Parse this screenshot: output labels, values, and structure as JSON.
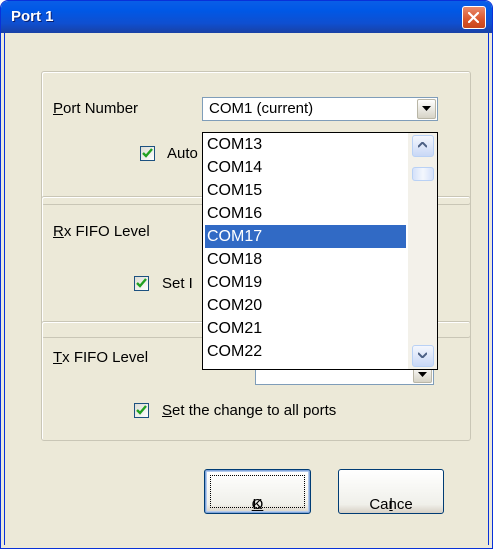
{
  "window": {
    "title": "Port 1",
    "close_icon": "close-icon"
  },
  "port_group": {
    "label_mnemonic": "P",
    "label_rest": "ort Number",
    "combo_value": "COM1 (current)",
    "checkbox_label": "Auto",
    "checkbox_checked": true
  },
  "rx_group": {
    "label_mnemonic": "R",
    "label_rest": "x FIFO Level",
    "checkbox_label": "Set I",
    "checkbox_checked": true
  },
  "tx_group": {
    "label_mnemonic": "T",
    "label_rest": "x FIFO Level",
    "checkbox_label_mnemonic": "S",
    "checkbox_label_rest": "et the change to all ports",
    "checkbox_checked": true
  },
  "dropdown": {
    "items": [
      "COM13",
      "COM14",
      "COM15",
      "COM16",
      "COM17",
      "COM18",
      "COM19",
      "COM20",
      "COM21",
      "COM22"
    ],
    "selected": "COM17"
  },
  "buttons": {
    "ok_mnemonic": "O",
    "ok_rest": "K",
    "cancel_start": "Cance",
    "cancel_mnemonic": "l"
  },
  "colors": {
    "title_bar": "#0a5ee7",
    "selection": "#316ac5",
    "dialog_bg": "#ece9d8"
  }
}
